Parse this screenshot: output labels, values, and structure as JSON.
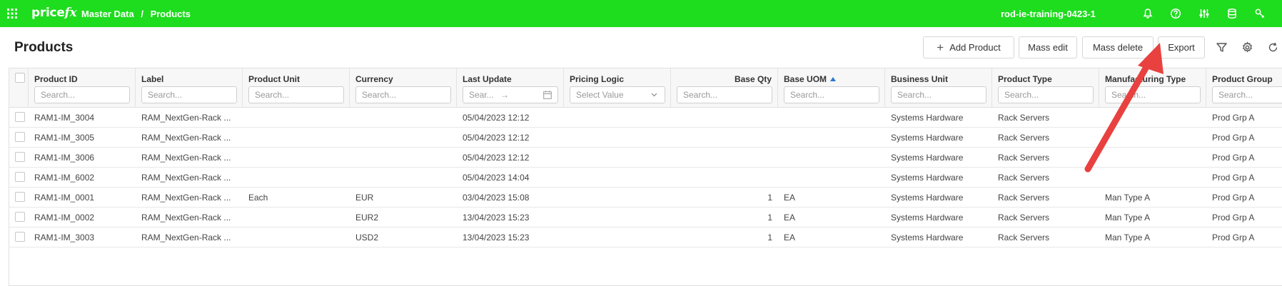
{
  "topbar": {
    "logo_main": "price",
    "logo_accent": "fx",
    "breadcrumb": [
      "Master Data",
      "/",
      "Products"
    ],
    "partition": "rod-ie-training-0423-1",
    "icons": [
      "bell-icon",
      "help-icon",
      "sliders-icon",
      "database-icon",
      "stack-icon",
      "tools-icon"
    ]
  },
  "page": {
    "title": "Products",
    "buttons": {
      "add": "Add Product",
      "mass_edit": "Mass edit",
      "mass_delete": "Mass delete",
      "export": "Export"
    }
  },
  "table": {
    "columns": [
      "Product ID",
      "Label",
      "Product Unit",
      "Currency",
      "Last Update",
      "Pricing Logic",
      "Base Qty",
      "Base UOM",
      "Business Unit",
      "Product Type",
      "Manufacturing Type",
      "Product Group"
    ],
    "search_placeholder": "Search...",
    "date_placeholder": "Sear...",
    "date_arrow": "→",
    "select_placeholder": "Select Value",
    "rows": [
      [
        "RAM1-IM_3004",
        "RAM_NextGen-Rack ...",
        "",
        "",
        "05/04/2023 12:12",
        "",
        "",
        "",
        "Systems Hardware",
        "Rack Servers",
        "",
        "Prod Grp A"
      ],
      [
        "RAM1-IM_3005",
        "RAM_NextGen-Rack ...",
        "",
        "",
        "05/04/2023 12:12",
        "",
        "",
        "",
        "Systems Hardware",
        "Rack Servers",
        "",
        "Prod Grp A"
      ],
      [
        "RAM1-IM_3006",
        "RAM_NextGen-Rack ...",
        "",
        "",
        "05/04/2023 12:12",
        "",
        "",
        "",
        "Systems Hardware",
        "Rack Servers",
        "",
        "Prod Grp A"
      ],
      [
        "RAM1-IM_6002",
        "RAM_NextGen-Rack ...",
        "",
        "",
        "05/04/2023 14:04",
        "",
        "",
        "",
        "Systems Hardware",
        "Rack Servers",
        "",
        "Prod Grp A"
      ],
      [
        "RAM1-IM_0001",
        "RAM_NextGen-Rack ...",
        "Each",
        "EUR",
        "03/04/2023 15:08",
        "",
        "1",
        "EA",
        "Systems Hardware",
        "Rack Servers",
        "Man Type A",
        "Prod Grp A"
      ],
      [
        "RAM1-IM_0002",
        "RAM_NextGen-Rack ...",
        "",
        "EUR2",
        "13/04/2023 15:23",
        "",
        "1",
        "EA",
        "Systems Hardware",
        "Rack Servers",
        "Man Type A",
        "Prod Grp A"
      ],
      [
        "RAM1-IM_3003",
        "RAM_NextGen-Rack ...",
        "",
        "USD2",
        "13/04/2023 15:23",
        "",
        "1",
        "EA",
        "Systems Hardware",
        "Rack Servers",
        "Man Type A",
        "Prod Grp A"
      ]
    ]
  },
  "colors": {
    "topbar": "#1edc1e",
    "annotation_arrow": "#e8413f",
    "sort_indicator": "#2a7ad0"
  }
}
